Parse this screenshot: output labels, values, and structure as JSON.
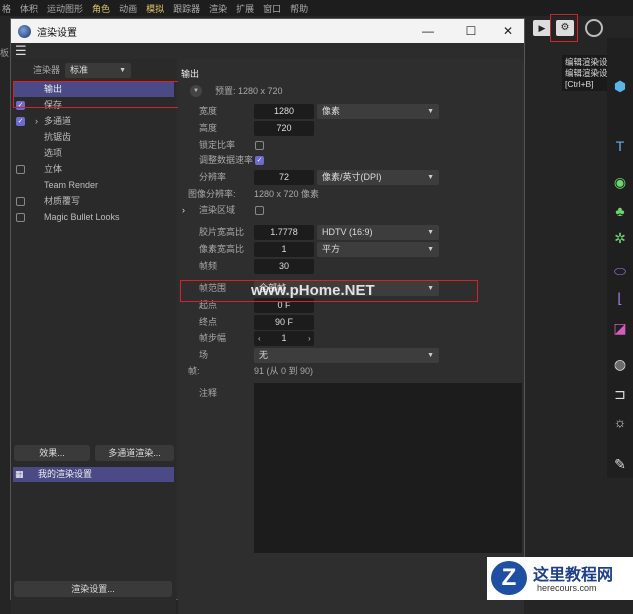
{
  "menubar": [
    "格",
    "体积",
    "运动图形",
    "角色",
    "动画",
    "模拟",
    "跟踪器",
    "渲染",
    "扩展",
    "窗口",
    "帮助"
  ],
  "dialog": {
    "title": "渲染设置",
    "minimize": "—",
    "maximize": "☐",
    "close": "✕"
  },
  "left": {
    "renderer_label": "渲染器",
    "renderer_value": "标准",
    "items": [
      {
        "label": "输出"
      },
      {
        "label": "保存"
      },
      {
        "label": "多通道"
      },
      {
        "label": "抗锯齿"
      },
      {
        "label": "选项"
      },
      {
        "label": "立体"
      },
      {
        "label": "Team Render"
      },
      {
        "label": "材质覆写"
      },
      {
        "label": "Magic Bullet Looks"
      }
    ],
    "effects_button": "效果...",
    "multipass_button": "多通道渲染...",
    "setting_item": "我的渲染设置",
    "render_settings_button": "渲染设置..."
  },
  "right": {
    "section": "输出",
    "preset": "预置: 1280 x 720",
    "width_label": "宽度",
    "width": "1280",
    "unit": "像素",
    "height_label": "高度",
    "height": "720",
    "lock_ratio": "锁定比率",
    "adapt_rate": "调整数据速率",
    "resolution_label": "分辨率",
    "resolution": "72",
    "resolution_unit": "像素/英寸(DPI)",
    "image_res_label": "图像分辨率:",
    "image_res": "1280 x 720 像素",
    "render_region": "渲染区域",
    "film_aspect_label": "胶片宽高比",
    "film_aspect": "1.7778",
    "film_aspect_preset": "HDTV (16:9)",
    "pixel_aspect_label": "像素宽高比",
    "pixel_aspect": "1",
    "pixel_aspect_preset": "平方",
    "fps_label": "帧频",
    "fps": "30",
    "frame_range_label": "帧范围",
    "frame_range": "全部帧",
    "start_label": "起点",
    "start": "0 F",
    "end_label": "终点",
    "end": "90 F",
    "step_label": "帧步幅",
    "step": "1",
    "field_label": "场",
    "field": "无",
    "frames_label": "帧:",
    "frames": "91 (从 0 到 90)",
    "notes_label": "注释"
  },
  "tooltip": [
    "编辑渲染设置...",
    "编辑渲染设置...",
    "[Ctrl+B]"
  ],
  "side_label": "板",
  "watermark": "www.pHome.NET",
  "brand": {
    "name": "这里教程网",
    "url": "herecours.com"
  }
}
